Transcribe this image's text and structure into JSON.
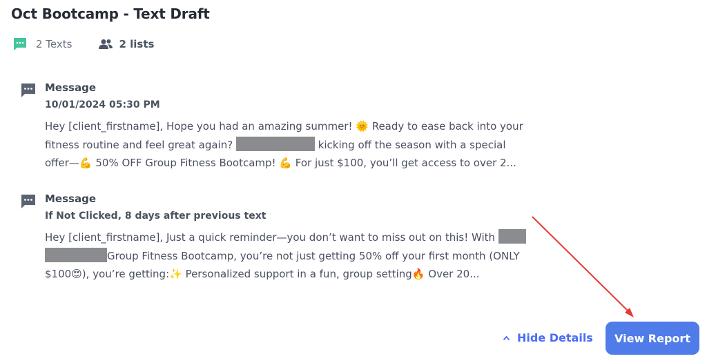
{
  "header": {
    "title": "Oct Bootcamp - Text Draft"
  },
  "stats": {
    "texts_label": "2 Texts",
    "lists_label": "2 lists"
  },
  "messages": [
    {
      "type": "Message",
      "meta": "10/01/2024 05:30 PM",
      "text_parts": {
        "a": "Hey [client_firstname], Hope you had an amazing summer! 🌞 Ready to ease back into your fitness routine and feel great again? ",
        "b": " kicking off the season with a special offer—💪 50% OFF Group Fitness Bootcamp! 💪 For just $100, you’ll get access to over 2..."
      }
    },
    {
      "type": "Message",
      "meta": "If Not Clicked, 8 days after previous text",
      "text_parts": {
        "a": "Hey [client_firstname], Just a quick reminder—you don’t want to miss out on this! With ",
        "b": "Group Fitness Bootcamp, you’re not just getting 50% off your first month (ONLY $100😍), you’re getting:✨ Personalized support in a fun, group setting🔥 Over 20..."
      }
    }
  ],
  "footer": {
    "hide_details_label": "Hide Details",
    "view_report_label": "View Report"
  },
  "icons": {
    "texts": "chat-bubble-icon",
    "lists": "people-icon",
    "message": "message-icon",
    "chevron": "chevron-up-icon"
  },
  "colors": {
    "accent": "#4f7ce8",
    "link": "#4a6cf7",
    "sms_icon": "#43c59e",
    "annotation_arrow": "#e53935"
  }
}
